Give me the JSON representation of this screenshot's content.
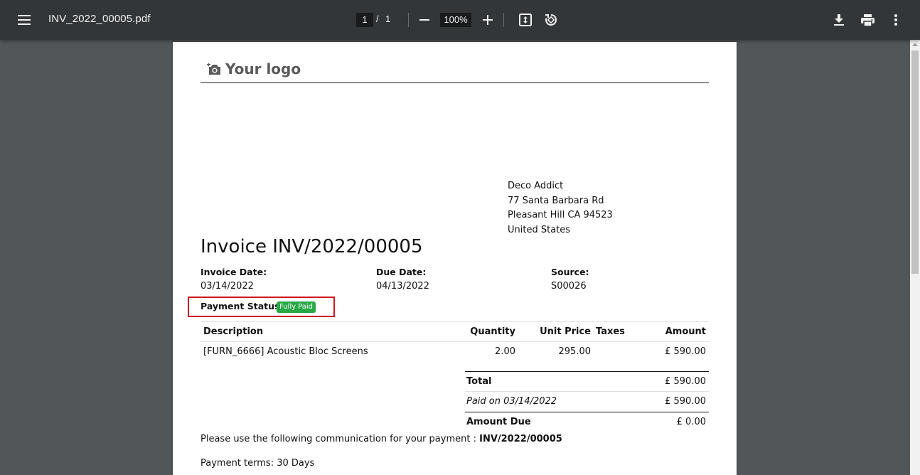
{
  "viewer": {
    "filename": "INV_2022_00005.pdf",
    "page_current": "1",
    "page_separator": "/",
    "page_total": "1",
    "zoom": "100%"
  },
  "document": {
    "logo_text": "Your logo",
    "address": {
      "name": "Deco Addict",
      "line1": "77 Santa Barbara Rd",
      "line2": "Pleasant Hill CA 94523",
      "country": "United States"
    },
    "title": "Invoice INV/2022/00005",
    "meta": {
      "invoice_date_label": "Invoice Date:",
      "invoice_date": "03/14/2022",
      "due_date_label": "Due Date:",
      "due_date": "04/13/2022",
      "source_label": "Source:",
      "source": "S00026"
    },
    "payment_status_label": "Payment Status :",
    "payment_status_badge": "Fully Paid",
    "table": {
      "headers": {
        "description": "Description",
        "quantity": "Quantity",
        "unit_price": "Unit Price",
        "taxes": "Taxes",
        "amount": "Amount"
      },
      "rows": [
        {
          "description": "[FURN_6666] Acoustic Bloc Screens",
          "quantity": "2.00",
          "unit_price": "295.00",
          "taxes": "",
          "amount": "£ 590.00"
        }
      ]
    },
    "totals": {
      "total_label": "Total",
      "total_value": "£ 590.00",
      "paid_label": "Paid on 03/14/2022",
      "paid_value": "£ 590.00",
      "amount_due_label": "Amount Due",
      "amount_due_value": "£ 0.00"
    },
    "communication_text": "Please use the following communication for your payment :",
    "communication_ref": "INV/2022/00005",
    "payment_terms": "Payment terms: 30 Days"
  },
  "colors": {
    "toolbar_bg": "#323639",
    "viewer_bg": "#525659",
    "badge_green": "#28a745",
    "highlight_red": "#d0151e"
  }
}
